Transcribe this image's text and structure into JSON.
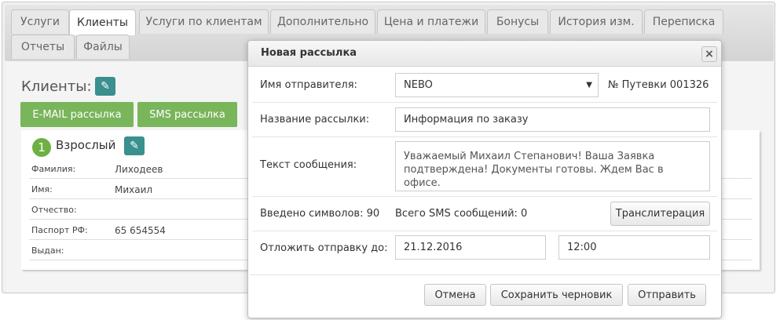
{
  "tabs": [
    {
      "label": "Услуги",
      "active": false
    },
    {
      "label": "Клиенты",
      "active": true
    },
    {
      "label": "Услуги по клиентам",
      "active": false
    },
    {
      "label": "Дополнительно",
      "active": false
    },
    {
      "label": "Цена и платежи",
      "active": false
    },
    {
      "label": "Бонусы",
      "active": false
    },
    {
      "label": "История изм.",
      "active": false
    },
    {
      "label": "Переписка",
      "active": false
    },
    {
      "label": "Отчеты",
      "active": false
    },
    {
      "label": "Файлы",
      "active": false
    }
  ],
  "clients": {
    "title": "Клиенты:",
    "email_button": "E-MAIL рассылка",
    "sms_button": "SMS рассылка",
    "card": {
      "number": "1",
      "title": "Взрослый",
      "rows": [
        {
          "label": "Фамилия:",
          "value": "Лиходеев"
        },
        {
          "label": "Имя:",
          "value": "Михаил"
        },
        {
          "label": "Отчество:",
          "value": ""
        },
        {
          "label": "Паспорт РФ:",
          "value": "65 654554"
        },
        {
          "label": "Выдан:",
          "value": ""
        }
      ]
    }
  },
  "modal": {
    "title": "Новая рассылка",
    "close_glyph": "×",
    "sender_label": "Имя отправителя:",
    "sender_value": "NEBO",
    "select_arrow": "▼",
    "voucher_text": "№ Путевки 001326",
    "name_label": "Название рассылки:",
    "name_value": "Информация по заказу",
    "message_label": "Текст сообщения:",
    "message_value": "Уважаемый Михаил Степанович! Ваша Заявка подтверждена! Документы готовы. Ждем Вас в офисе.",
    "chars_label": "Введено символов: 90",
    "sms_count_label": "Всего SMS сообщений: 0",
    "translit_button": "Транслитерация",
    "delay_label": "Отложить отправку до:",
    "delay_date": "21.12.2016",
    "delay_time": "12:00",
    "cancel_button": "Отмена",
    "save_draft_button": "Сохранить черновик",
    "send_button": "Отправить"
  },
  "colors": {
    "accent_green": "#79b55a",
    "edit_teal": "#3a8f8f"
  }
}
